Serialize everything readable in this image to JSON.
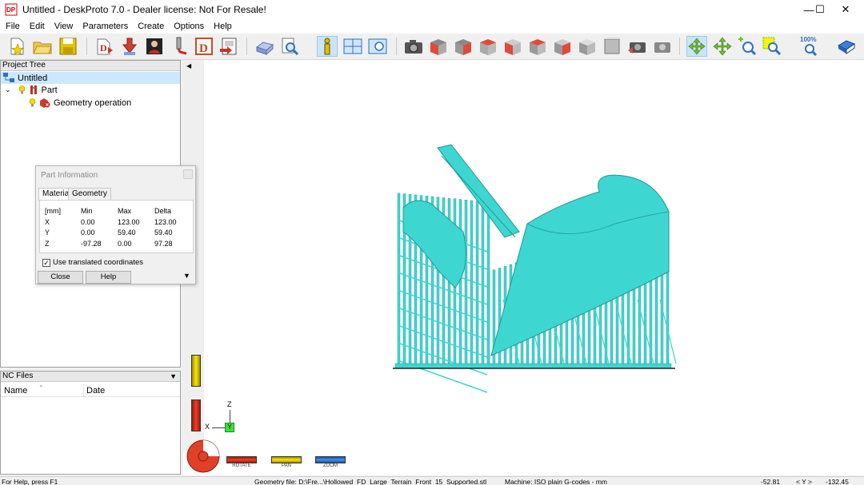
{
  "window": {
    "title": "Untitled - DeskProto 7.0 - Dealer license: Not For Resale!",
    "app_icon_text": "DP",
    "minimize": "—",
    "maximize": "☐",
    "close": "✕"
  },
  "menu": [
    "File",
    "Edit",
    "View",
    "Parameters",
    "Create",
    "Options",
    "Help"
  ],
  "toolbar": {
    "zoom_label": "100%",
    "buttons": [
      "new-icon",
      "open-icon",
      "save-icon",
      "part-wizard-icon",
      "operation-wizard-icon",
      "image-wizard-icon",
      "cutter-icon",
      "drawing-icon",
      "export-icon",
      "material-icon",
      "preview-icon",
      "info-icon",
      "layout-icon",
      "viewport-icon",
      "camera-icon",
      "view-front-icon",
      "view-right-icon",
      "view-back-icon",
      "view-left-icon",
      "view-top-icon",
      "view-bottom-icon",
      "view-iso-icon",
      "view-iso2-icon",
      "camera-reset-icon",
      "camera-alt-icon",
      "rotate-mode-icon",
      "pan-mode-icon",
      "zoom-mode-icon",
      "zoom-window-icon",
      "zoom-100-icon",
      "help-book-icon"
    ]
  },
  "project_tree": {
    "header": "Project Tree",
    "root": "Untitled",
    "part": "Part",
    "operation": "Geometry operation"
  },
  "nc_files": {
    "header": "NC Files",
    "col_name": "Name",
    "col_date": "Date"
  },
  "part_info": {
    "title": "Part Information",
    "tab_material": "Material",
    "tab_geometry": "Geometry",
    "headers": [
      "[mm]",
      "Min",
      "Max",
      "Delta"
    ],
    "rows": [
      [
        "X",
        "0.00",
        "123.00",
        "123.00"
      ],
      [
        "Y",
        "0.00",
        "59.40",
        "59.40"
      ],
      [
        "Z",
        "-97.28",
        "0.00",
        "97.28"
      ]
    ],
    "checkbox_label": "Use translated coordinates",
    "checkbox_checked": true,
    "close_label": "Close",
    "help_label": "Help"
  },
  "viewport": {
    "model_color": "#3ed6d0",
    "axis_z": "Z",
    "axis_x": "X",
    "axis_y": "Y",
    "mode_rotate": "ROTATE",
    "mode_pan": "PAN",
    "mode_zoom": "ZOOM"
  },
  "statusbar": {
    "help": "For Help, press F1",
    "geometry": "Geometry file: D:\\Fre...\\Hollowed_FD_Large_Terrain_Front_15_Supported.stl",
    "machine": "Machine: ISO plain G-codes - mm",
    "coord1": "-52.81",
    "coord_axis": "< Y >",
    "coord2": "-132.45"
  }
}
